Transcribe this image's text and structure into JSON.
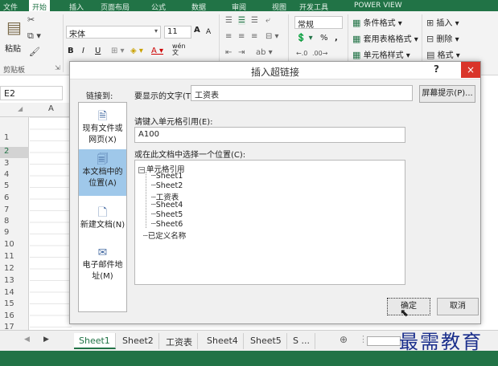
{
  "ribbon": {
    "tabs": [
      "文件",
      "开始",
      "插入",
      "页面布局",
      "公式",
      "数据",
      "审阅",
      "视图",
      "开发工具",
      "POWER VIEW"
    ],
    "clipboard": {
      "paste_label": "粘贴",
      "group_label": "剪贴板"
    },
    "font": {
      "name": "宋体",
      "size": "11",
      "grow": "A",
      "shrink": "A",
      "bold": "B",
      "italic": "I",
      "underline": "U",
      "wen": "wén\n文"
    },
    "number": {
      "format": "常规",
      "percent": "%",
      "comma": ","
    },
    "styles": {
      "conditional": "条件格式 ▾",
      "table": "套用表格格式 ▾",
      "cell": "单元格样式 ▾"
    },
    "cells": {
      "insert": "插入 ▾",
      "delete": "删除 ▾",
      "format": "格式 ▾"
    }
  },
  "namebox": {
    "value": "E2"
  },
  "grid": {
    "col_header": "A",
    "rows": [
      "1",
      "2",
      "3",
      "4",
      "5",
      "6",
      "7",
      "8",
      "9",
      "10",
      "11",
      "12",
      "13",
      "14",
      "15",
      "16",
      "17"
    ],
    "selected_row": "2"
  },
  "dialog": {
    "title": "插入超链接",
    "help": "?",
    "close": "×",
    "link_to_label": "链接到:",
    "display_text_label": "要显示的文字(T):",
    "display_text_value": "工资表",
    "screentip_button": "屏幕提示(P)...",
    "cell_ref_label": "请键入单元格引用(E):",
    "cell_ref_value": "A100",
    "place_label": "或在此文档中选择一个位置(C):",
    "link_options": [
      {
        "label": "现有文件或网页(X)",
        "icon": "globe-file-icon"
      },
      {
        "label": "本文档中的位置(A)",
        "icon": "document-place-icon"
      },
      {
        "label": "新建文档(N)",
        "icon": "new-document-icon"
      },
      {
        "label": "电子邮件地址(M)",
        "icon": "email-icon"
      }
    ],
    "tree": {
      "root": "单元格引用",
      "children": [
        "Sheet1",
        "Sheet2",
        "工资表",
        "Sheet4",
        "Sheet5",
        "Sheet6"
      ],
      "defined_names": "已定义名称"
    },
    "ok_button": "确定",
    "cancel_button": "取消"
  },
  "sheet_tabs": [
    "Sheet1",
    "Sheet2",
    "工资表",
    "Sheet4",
    "Sheet5",
    "S ..."
  ],
  "active_sheet": "Sheet1",
  "watermark": "最需教育"
}
